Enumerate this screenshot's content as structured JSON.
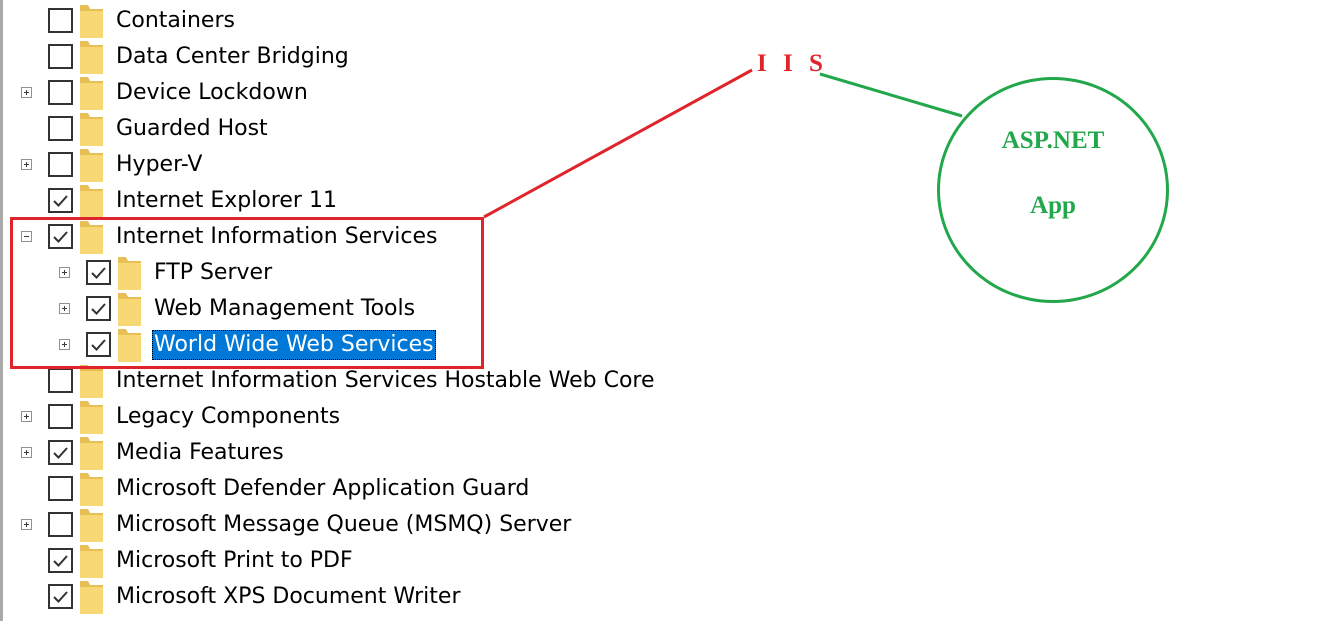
{
  "tree": {
    "items": [
      {
        "label": "Containers",
        "checked": false,
        "expander": "none",
        "level": 0,
        "selected": false
      },
      {
        "label": "Data Center Bridging",
        "checked": false,
        "expander": "none",
        "level": 0,
        "selected": false
      },
      {
        "label": "Device Lockdown",
        "checked": false,
        "expander": "plus",
        "level": 0,
        "selected": false
      },
      {
        "label": "Guarded Host",
        "checked": false,
        "expander": "none",
        "level": 0,
        "selected": false
      },
      {
        "label": "Hyper-V",
        "checked": false,
        "expander": "plus",
        "level": 0,
        "selected": false
      },
      {
        "label": "Internet Explorer 11",
        "checked": true,
        "expander": "none",
        "level": 0,
        "selected": false
      },
      {
        "label": "Internet Information Services",
        "checked": true,
        "expander": "minus",
        "level": 0,
        "selected": false
      },
      {
        "label": "FTP Server",
        "checked": true,
        "expander": "plus",
        "level": 1,
        "selected": false
      },
      {
        "label": "Web Management Tools",
        "checked": true,
        "expander": "plus",
        "level": 1,
        "selected": false
      },
      {
        "label": "World Wide Web Services",
        "checked": true,
        "expander": "plus",
        "level": 1,
        "selected": true
      },
      {
        "label": "Internet Information Services Hostable Web Core",
        "checked": false,
        "expander": "none",
        "level": 0,
        "selected": false
      },
      {
        "label": "Legacy Components",
        "checked": false,
        "expander": "plus",
        "level": 0,
        "selected": false
      },
      {
        "label": "Media Features",
        "checked": true,
        "expander": "plus",
        "level": 0,
        "selected": false
      },
      {
        "label": "Microsoft Defender Application Guard",
        "checked": false,
        "expander": "none",
        "level": 0,
        "selected": false
      },
      {
        "label": "Microsoft Message Queue (MSMQ) Server",
        "checked": false,
        "expander": "plus",
        "level": 0,
        "selected": false
      },
      {
        "label": "Microsoft Print to PDF",
        "checked": true,
        "expander": "none",
        "level": 0,
        "selected": false
      },
      {
        "label": "Microsoft XPS Document Writer",
        "checked": true,
        "expander": "none",
        "level": 0,
        "selected": false
      }
    ]
  },
  "annotations": {
    "iis_label": "I I S",
    "circle_title": "ASP.NET",
    "circle_subtitle": "App",
    "highlight_color": "#e0242b",
    "circle_color": "#22a84b"
  },
  "colors": {
    "selection": "#0078d7",
    "folder": "#f8d775"
  },
  "icons": {
    "folder": "folder-icon",
    "checkmark": "checkmark-icon",
    "expand": "expand-plus-icon",
    "collapse": "collapse-minus-icon"
  }
}
